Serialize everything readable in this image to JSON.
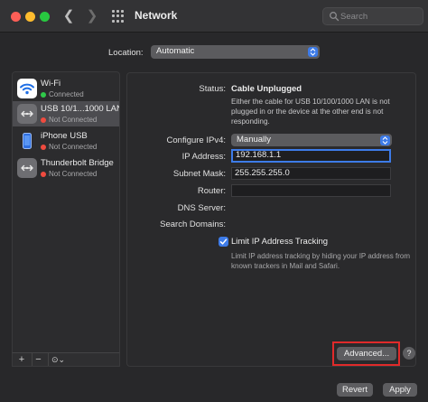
{
  "window": {
    "title": "Network",
    "search_placeholder": "Search"
  },
  "location": {
    "label": "Location:",
    "value": "Automatic"
  },
  "services": [
    {
      "name": "Wi-Fi",
      "status": "Connected",
      "status_color": "#2fc94a",
      "icon": "wifi-icon"
    },
    {
      "name": "USB 10/1...1000 LAN",
      "status": "Not Connected",
      "status_color": "#f04b3f",
      "icon": "ethernet-icon"
    },
    {
      "name": "iPhone USB",
      "status": "Not Connected",
      "status_color": "#f04b3f",
      "icon": "iphone-icon"
    },
    {
      "name": "Thunderbolt Bridge",
      "status": "Not Connected",
      "status_color": "#f04b3f",
      "icon": "thunderbolt-bridge-icon"
    }
  ],
  "sidebar_buttons": {
    "add": "+",
    "remove": "−",
    "action": "⊙⌄"
  },
  "detail": {
    "status_label": "Status:",
    "status_value": "Cable Unplugged",
    "status_description": "Either the cable for USB 10/100/1000 LAN is not plugged in or the device at the other end is not responding.",
    "configure_label": "Configure IPv4:",
    "configure_value": "Manually",
    "ip_label": "IP Address:",
    "ip_value": "192.168.1.1",
    "subnet_label": "Subnet Mask:",
    "subnet_value": "255.255.255.0",
    "router_label": "Router:",
    "router_value": "",
    "dns_label": "DNS Server:",
    "search_domains_label": "Search Domains:",
    "limit_tracking_label": "Limit IP Address Tracking",
    "limit_tracking_checked": true,
    "limit_tracking_description": "Limit IP address tracking by hiding your IP address from known trackers in Mail and Safari."
  },
  "buttons": {
    "advanced": "Advanced...",
    "help": "?",
    "revert": "Revert",
    "apply": "Apply"
  },
  "colors": {
    "accent": "#3d7be8",
    "highlight_outline": "#e02a2a"
  }
}
